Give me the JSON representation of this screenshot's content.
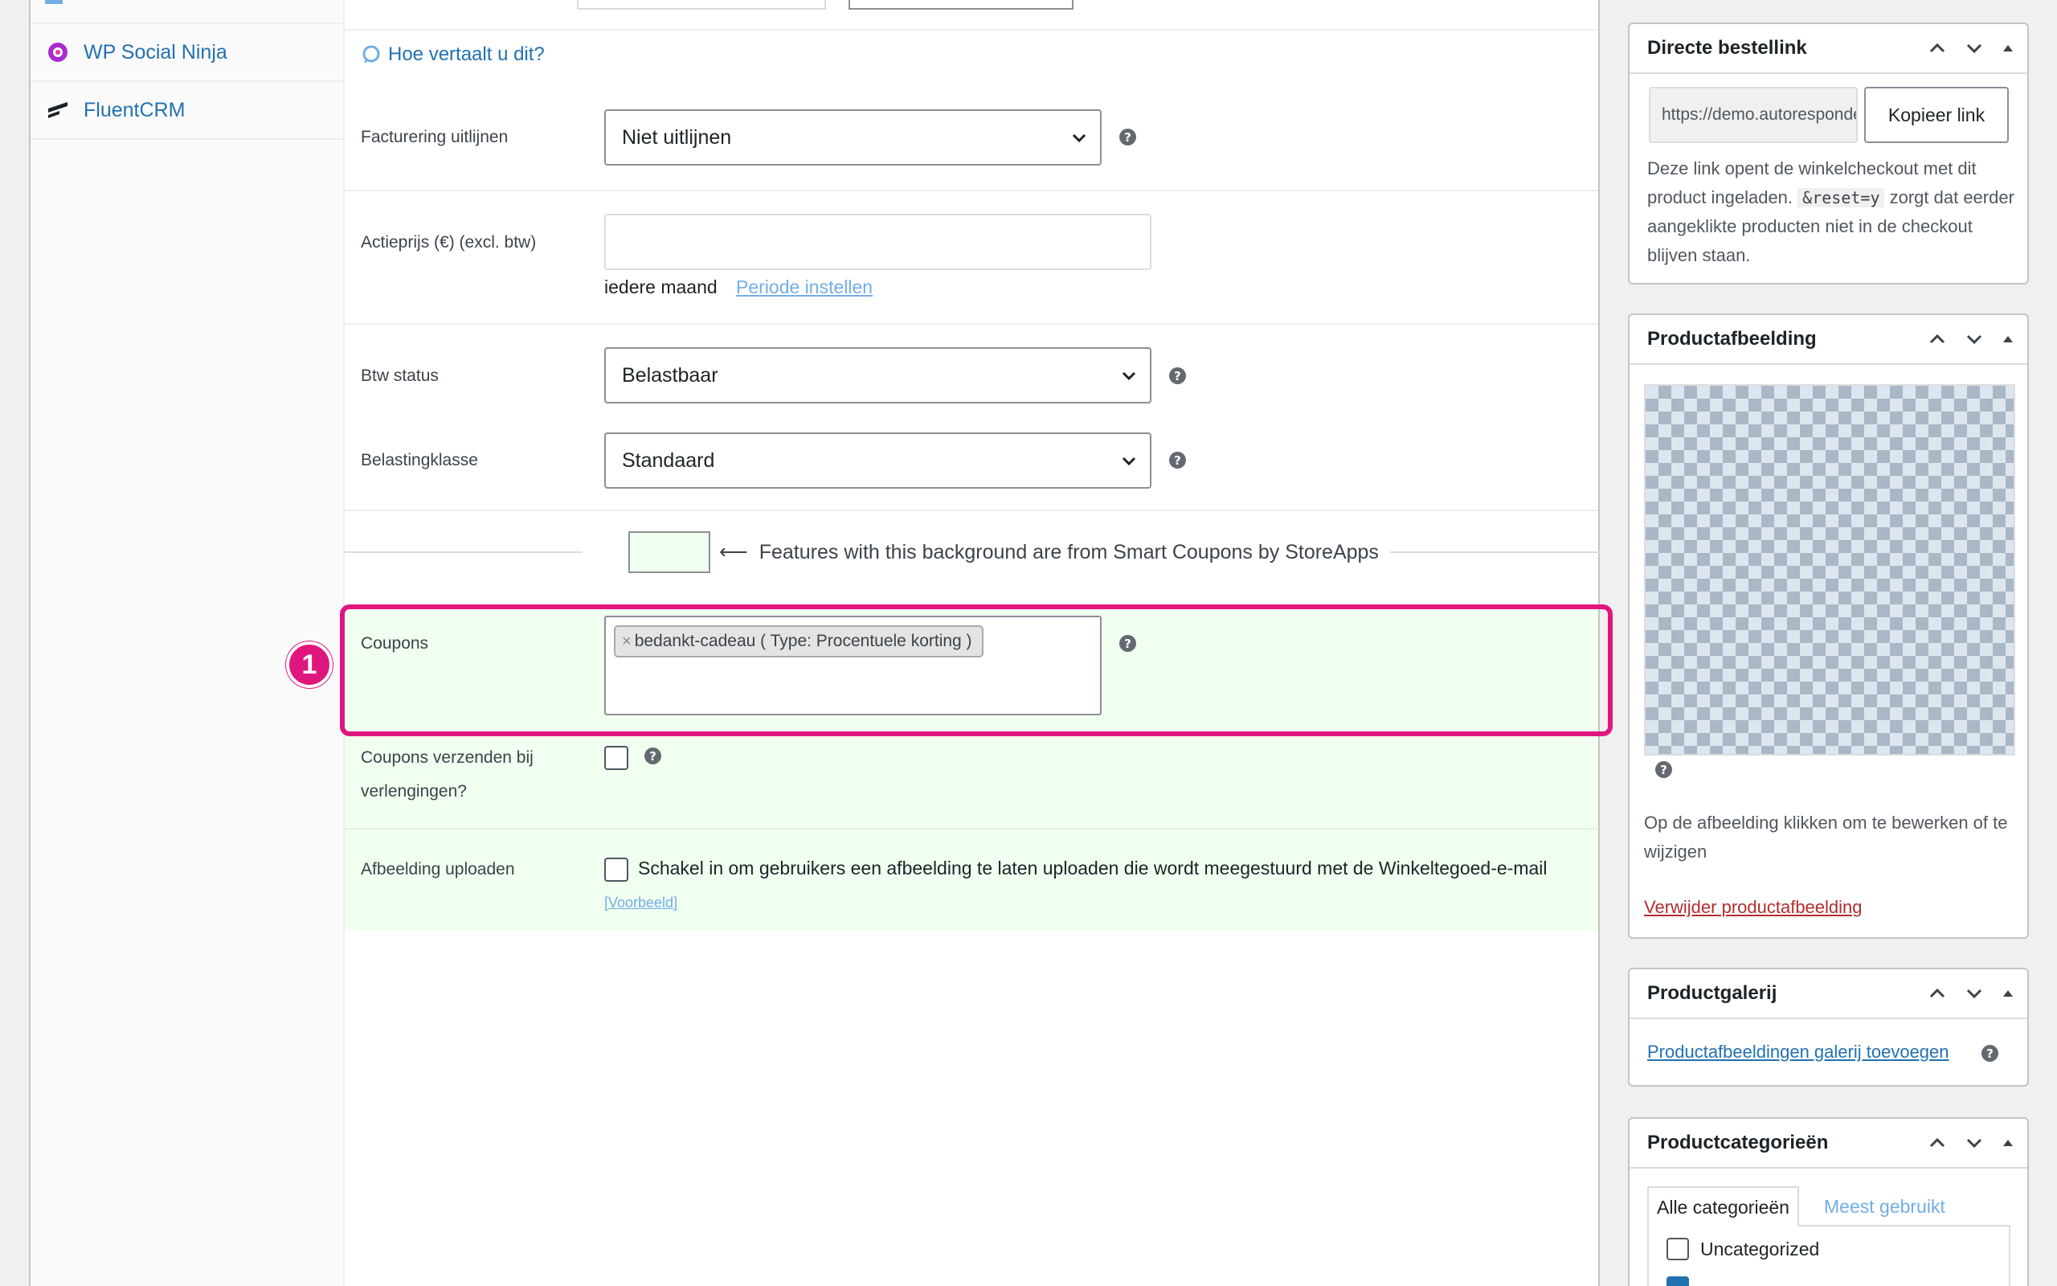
{
  "left_tabs": {
    "social_ninja": "WP Social Ninja",
    "fluentcrm": "FluentCRM"
  },
  "form": {
    "translate_link": "Hoe vertaalt u dit?",
    "billing_align": {
      "label": "Facturering uitlijnen",
      "value": "Niet uitlijnen"
    },
    "sale_price": {
      "label": "Actieprijs (€) (excl. btw)",
      "value": "",
      "period_text": "iedere maand",
      "period_link": "Periode instellen"
    },
    "tax_status": {
      "label": "Btw status",
      "value": "Belastbaar"
    },
    "tax_class": {
      "label": "Belastingklasse",
      "value": "Standaard"
    },
    "smart_coupons_note": "⟵  Features with this background are from Smart Coupons by StoreApps",
    "coupons": {
      "label": "Coupons",
      "tokens": [
        "bedankt-cadeau ( Type: Procentuele korting )"
      ],
      "remove_glyph": "×"
    },
    "send_coupons": {
      "label": "Coupons verzenden bij verlengingen?",
      "checked": false
    },
    "image_upload": {
      "label": "Afbeelding uploaden",
      "checkbox_text": "Schakel in om gebruikers een afbeelding te laten uploaden die wordt meegestuurd met de Winkeltegoed-e-mail",
      "preview_link": "[Voorbeeld]",
      "checked": false
    }
  },
  "annotation": {
    "number": "1",
    "color": "#e0167f"
  },
  "help_glyph": "?",
  "sidebar": {
    "direct_link": {
      "title": "Directe bestellink",
      "url": "https://demo.autoresponder",
      "copy_button": "Kopieer link",
      "desc_part1": "Deze link opent de winkelcheckout met dit product ingeladen.",
      "code": "&reset=y",
      "desc_part2": "zorgt dat eerder aangeklikte producten niet in de checkout blijven staan."
    },
    "product_image": {
      "title": "Productafbeelding",
      "hint": "Op de afbeelding klikken om te bewerken of te wijzigen",
      "remove_link": "Verwijder productafbeelding"
    },
    "gallery": {
      "title": "Productgalerij",
      "add_link": "Productafbeeldingen galerij toevoegen"
    },
    "categories": {
      "title": "Productcategorieën",
      "tab_all": "Alle categorieën",
      "tab_most": "Meest gebruikt",
      "items": [
        "Uncategorized"
      ]
    }
  },
  "colors": {
    "accent": "#2271b1",
    "green_bg": "#f0fff0",
    "annotation": "#e0167f",
    "danger": "#b32d2e"
  }
}
